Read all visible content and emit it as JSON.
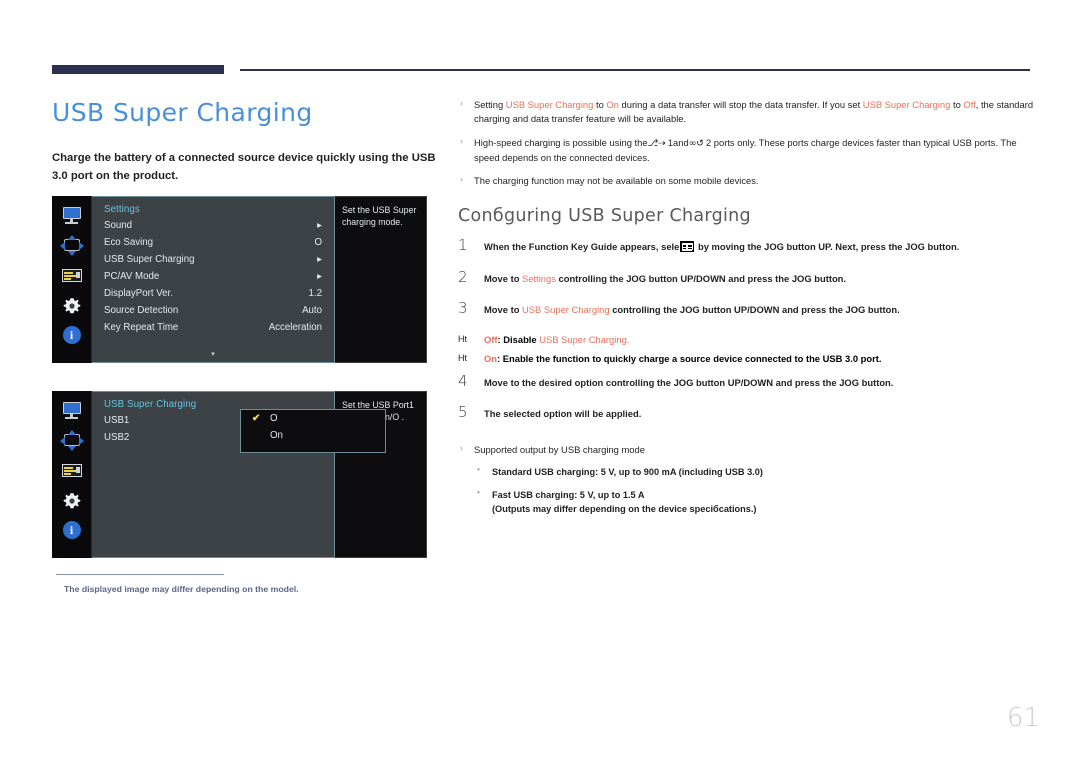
{
  "page": {
    "title": "USB Super Charging",
    "lead": "Charge the battery of a connected source device quickly using the USB 3.0 port on the product.",
    "number": "61",
    "footnote": "The displayed image may differ depending on the model."
  },
  "osd_settings": {
    "header": "Settings",
    "rows": [
      {
        "label": "Sound",
        "value": "▸"
      },
      {
        "label": "Eco Saving",
        "value": "O"
      },
      {
        "label": "USB Super Charging",
        "value": "▸"
      },
      {
        "label": "PC/AV Mode",
        "value": "▸"
      },
      {
        "label": "DisplayPort Ver.",
        "value": "1.2"
      },
      {
        "label": "Source Detection",
        "value": "Auto"
      },
      {
        "label": "Key Repeat Time",
        "value": "Acceleration"
      }
    ],
    "scroll_down": "▾",
    "description": "Set the USB Super charging mode.",
    "icons": [
      "monitor-icon",
      "move-icon",
      "list-icon",
      "gear-icon",
      "info-icon"
    ]
  },
  "osd_usb": {
    "header": "USB Super Charging",
    "rows": [
      {
        "label": "USB1"
      },
      {
        "label": "USB2"
      }
    ],
    "options": [
      {
        "label": "O",
        "checked": true,
        "check": "✔"
      },
      {
        "label": "On",
        "checked": false,
        "check": "✔"
      }
    ],
    "description": "Set the USB Port1 charging On/O .",
    "icons": [
      "monitor-icon",
      "move-icon",
      "list-icon",
      "gear-icon",
      "info-icon"
    ]
  },
  "notes": {
    "b1_p1": "Setting ",
    "b1_h1": "USB Super Charging",
    "b1_p2": " to ",
    "b1_h2": "On",
    "b1_p3": "  during a data transfer will stop the data transfer. If you set ",
    "b1_h3": "USB Super Charging",
    "b1_p4": " to ",
    "b1_h4": "Off",
    "b1_p5": ", the standard charging and data transfer feature will be available.",
    "b2_p1": "High-speed charging is possible using the",
    "b2_sym1": "⎇⇢",
    "b2_p2": " 1and",
    "b2_sym2": "∞↺",
    "b2_p3": " 2 ports only. These ports charge devices faster than typical USB ports. The speed depends on the connected devices.",
    "b3": "The charging function may not be available on some mobile devices."
  },
  "config": {
    "title": "Conбguring  USB Super Charging",
    "steps": [
      {
        "num": "1",
        "pre": "When the Function Key Guide appears, sele",
        "icon": "menu-icon",
        "post": " by moving the JOG button UP. Next, press the JOG button."
      },
      {
        "num": "2",
        "pre": "Move to ",
        "hl": "Settings",
        "post": " controlling the JOG button UP/DOWN and press the JOG button."
      },
      {
        "num": "3",
        "pre": "Move to ",
        "hl": "USB Super Charging",
        "post": " controlling the JOG button UP/DOWN and press the JOG button."
      },
      {
        "num": "4",
        "pre": "Move to the desired option controlling the JOG button UP/DOWN and press the JOG button.",
        "hl": "",
        "post": ""
      },
      {
        "num": "5",
        "pre": "The selected option will be applied.",
        "hl": "",
        "post": ""
      }
    ],
    "sub_off_mark": "Ht",
    "sub_off_h1": "Off",
    "sub_off_p1": ": Disable ",
    "sub_off_h2": "USB Super Charging",
    "sub_off_p2": ".",
    "sub_on_mark": "Ht",
    "sub_on_h1": "On",
    "sub_on_p1": ": Enable the function to quickly charge a source device connected to the USB 3.0 port."
  },
  "supported": {
    "title": "Supported output by USB charging mode",
    "item1": "Standard USB charging: 5 V, up to 900 mA (including USB 3.0)",
    "item2": "Fast USB charging: 5 V, up to 1.5 A",
    "item2b": "(Outputs may differ depending on the device speciбcations.)"
  },
  "colors": {
    "title_blue": "#4a90d9",
    "accent_red": "#e8715a",
    "rule_navy": "#2b3050",
    "osd_panel": "#3c4246",
    "osd_header": "#66c4e0",
    "check_yellow": "#f2e436"
  }
}
